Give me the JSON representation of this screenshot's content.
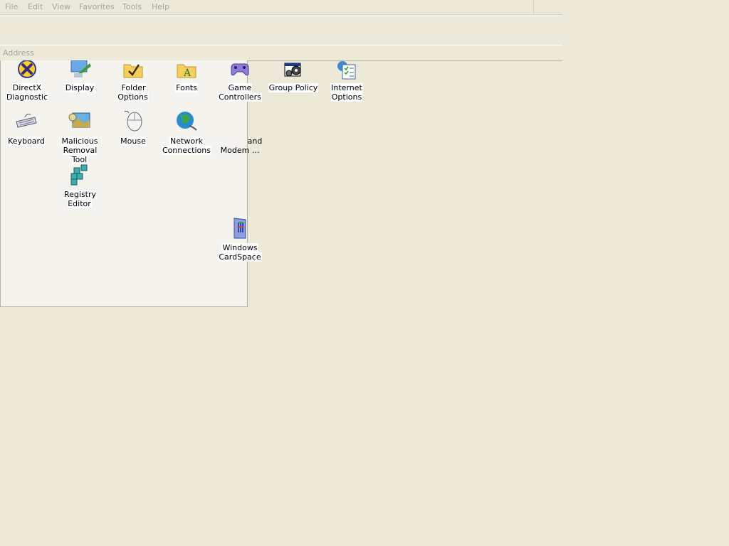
{
  "menu": {
    "file": "File",
    "edit": "Edit",
    "view": "View",
    "favorites": "Favorites",
    "tools": "Tools",
    "help": "Help"
  },
  "address": {
    "label": "Address"
  },
  "icons": {
    "directx": {
      "line1": "DirectX",
      "line2": "Diagnostic"
    },
    "display": {
      "line1": "Display",
      "line2": ""
    },
    "folder_options": {
      "line1": "Folder Options",
      "line2": ""
    },
    "fonts": {
      "line1": "Fonts",
      "line2": ""
    },
    "game_controllers": {
      "line1": "Game",
      "line2": "Controllers"
    },
    "group_policy": {
      "line1": "Group Policy",
      "line2": ""
    },
    "internet_options": {
      "line1": "Internet",
      "line2": "Options"
    },
    "keyboard": {
      "line1": "Keyboard",
      "line2": ""
    },
    "malicious_removal": {
      "line1": "Malicious",
      "line2": "Removal Tool"
    },
    "mouse": {
      "line1": "Mouse",
      "line2": ""
    },
    "network_connections": {
      "line1": "Network",
      "line2": "Connections"
    },
    "phone_modem": {
      "line1": "and",
      "line2": "Modem ..."
    },
    "registry_editor": {
      "line1": "Registry Editor",
      "line2": ""
    },
    "windows_cardspace": {
      "line1": "Windows",
      "line2": "CardSpace"
    }
  }
}
